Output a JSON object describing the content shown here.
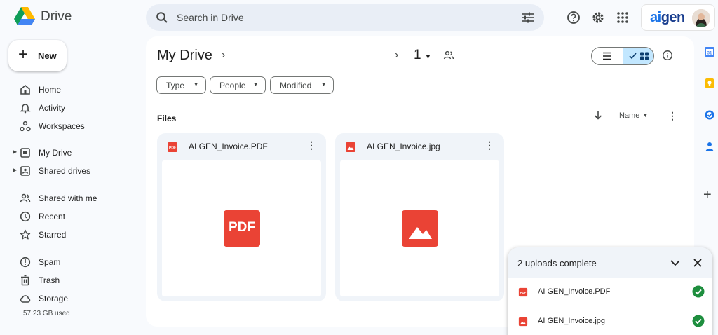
{
  "app": {
    "name": "Drive"
  },
  "search": {
    "placeholder": "Search in Drive"
  },
  "brand": {
    "logo_text_a": "ai",
    "logo_text_b": "gen"
  },
  "sidebar": {
    "new_label": "New",
    "items": [
      {
        "label": "Home",
        "icon": "home-icon"
      },
      {
        "label": "Activity",
        "icon": "bell-icon"
      },
      {
        "label": "Workspaces",
        "icon": "workspaces-icon"
      },
      {
        "label": "My Drive",
        "icon": "my-drive-icon"
      },
      {
        "label": "Shared drives",
        "icon": "shared-drives-icon"
      },
      {
        "label": "Shared with me",
        "icon": "people-icon"
      },
      {
        "label": "Recent",
        "icon": "clock-icon"
      },
      {
        "label": "Starred",
        "icon": "star-icon"
      },
      {
        "label": "Spam",
        "icon": "spam-icon"
      },
      {
        "label": "Trash",
        "icon": "trash-icon"
      },
      {
        "label": "Storage",
        "icon": "cloud-icon"
      }
    ],
    "storage_used": "57.23 GB used"
  },
  "main": {
    "title": "My Drive",
    "mid_count": "1",
    "filters": [
      "Type",
      "People",
      "Modified"
    ],
    "section_label": "Files",
    "sort_label": "Name",
    "files": [
      {
        "name": "AI GEN_Invoice.PDF",
        "type": "pdf",
        "thumb_text": "PDF"
      },
      {
        "name": "AI GEN_Invoice.jpg",
        "type": "image",
        "thumb_text": ""
      }
    ]
  },
  "uploads": {
    "title": "2 uploads complete",
    "items": [
      {
        "name": "AI GEN_Invoice.PDF",
        "type": "pdf"
      },
      {
        "name": "AI GEN_Invoice.jpg",
        "type": "image"
      }
    ]
  },
  "colors": {
    "accent": "#1a73e8",
    "selected_toggle": "#c2e7ff",
    "file_red": "#ea4335",
    "success_green": "#1e8e3e",
    "panel_bg": "#f8fafd"
  }
}
